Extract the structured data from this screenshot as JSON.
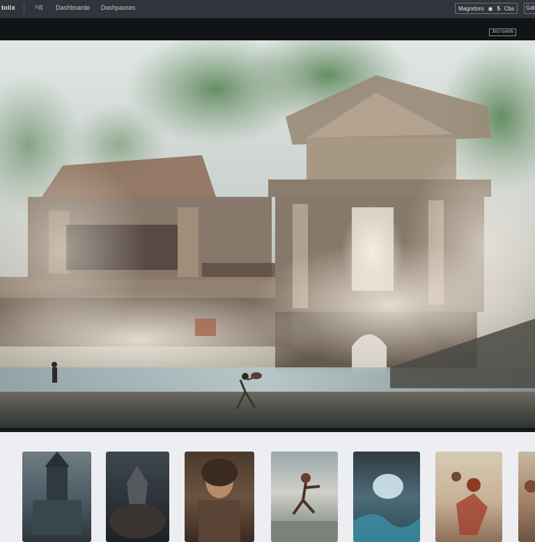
{
  "topbar": {
    "brand": "tolix",
    "nav": [
      "¹¹ß",
      "Dashboarde",
      "Dashpasses"
    ],
    "account_label": "Magnrtoro",
    "account_count": "5",
    "account_extra": "Cbs",
    "account_icon": "user-icon",
    "corner_label": "Gdi"
  },
  "subbar": {
    "button_label": "Jicct Ioolofs"
  },
  "hero": {
    "image": "misty-ruined-temple-painting"
  },
  "thumbnails": [
    {
      "image": "ruined-tower-painting"
    },
    {
      "image": "dark-armored-figure-painting"
    },
    {
      "image": "smiling-woman-portrait-painting"
    },
    {
      "image": "running-figures-painting"
    },
    {
      "image": "storm-cave-painting"
    },
    {
      "image": "red-haired-warrior-painting"
    },
    {
      "image": "partial-thumbnail-painting"
    }
  ],
  "colors": {
    "topbar_bg": "#30353b",
    "subbar_bg": "#111316",
    "page_bg": "#eceef1"
  }
}
